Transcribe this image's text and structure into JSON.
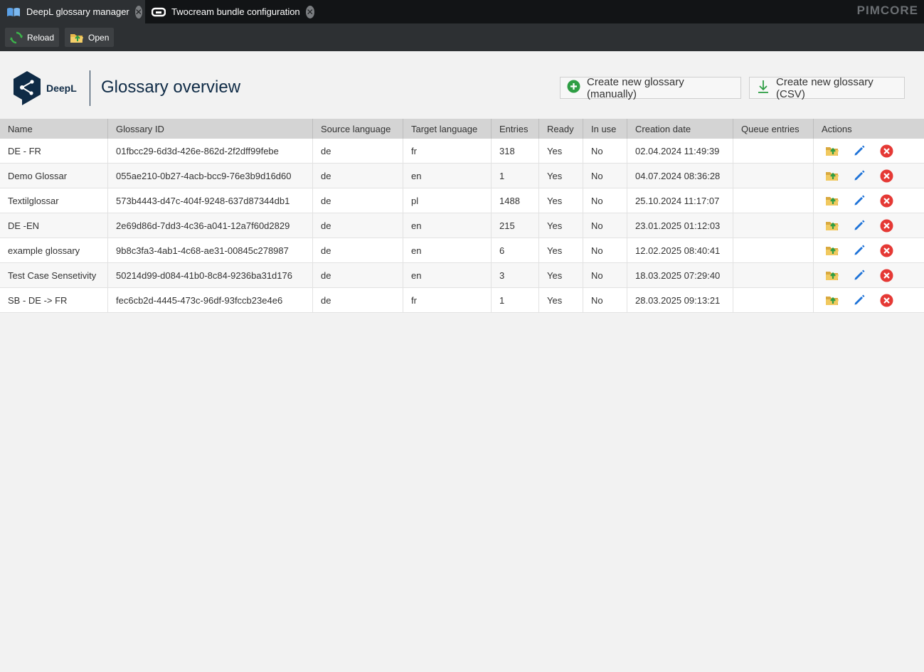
{
  "tabs": [
    {
      "label": "DeepL glossary manager",
      "icon": "book-icon",
      "active": true
    },
    {
      "label": "Twocream bundle configuration",
      "icon": "bundle-icon",
      "active": false
    }
  ],
  "brand": "PIMCORE",
  "toolbar": {
    "reload_label": "Reload",
    "open_label": "Open"
  },
  "header": {
    "logo_text": "DeepL",
    "title": "Glossary overview",
    "create_manual_label": "Create new glossary (manually)",
    "create_csv_label": "Create new glossary (CSV)"
  },
  "grid": {
    "columns": [
      "Name",
      "Glossary ID",
      "Source language",
      "Target language",
      "Entries",
      "Ready",
      "In use",
      "Creation date",
      "Queue entries",
      "Actions"
    ],
    "rows": [
      {
        "name": "DE - FR",
        "id": "01fbcc29-6d3d-426e-862d-2f2dff99febe",
        "source": "de",
        "target": "fr",
        "entries": "318",
        "ready": "Yes",
        "in_use": "No",
        "created": "02.04.2024 11:49:39",
        "queue": ""
      },
      {
        "name": "Demo Glossar",
        "id": "055ae210-0b27-4acb-bcc9-76e3b9d16d60",
        "source": "de",
        "target": "en",
        "entries": "1",
        "ready": "Yes",
        "in_use": "No",
        "created": "04.07.2024 08:36:28",
        "queue": ""
      },
      {
        "name": "Textilglossar",
        "id": "573b4443-d47c-404f-9248-637d87344db1",
        "source": "de",
        "target": "pl",
        "entries": "1488",
        "ready": "Yes",
        "in_use": "No",
        "created": "25.10.2024 11:17:07",
        "queue": ""
      },
      {
        "name": "DE -EN",
        "id": "2e69d86d-7dd3-4c36-a041-12a7f60d2829",
        "source": "de",
        "target": "en",
        "entries": "215",
        "ready": "Yes",
        "in_use": "No",
        "created": "23.01.2025 01:12:03",
        "queue": ""
      },
      {
        "name": "example glossary",
        "id": "9b8c3fa3-4ab1-4c68-ae31-00845c278987",
        "source": "de",
        "target": "en",
        "entries": "6",
        "ready": "Yes",
        "in_use": "No",
        "created": "12.02.2025 08:40:41",
        "queue": ""
      },
      {
        "name": "Test Case Sensetivity",
        "id": "50214d99-d084-41b0-8c84-9236ba31d176",
        "source": "de",
        "target": "en",
        "entries": "3",
        "ready": "Yes",
        "in_use": "No",
        "created": "18.03.2025 07:29:40",
        "queue": ""
      },
      {
        "name": "SB - DE -> FR",
        "id": "fec6cb2d-4445-473c-96df-93fccb23e4e6",
        "source": "de",
        "target": "fr",
        "entries": "1",
        "ready": "Yes",
        "in_use": "No",
        "created": "28.03.2025 09:13:21",
        "queue": ""
      }
    ],
    "action_icons": [
      "folder-upload-icon",
      "pencil-icon",
      "delete-icon"
    ]
  },
  "colors": {
    "accent": "#0f2b46",
    "delete": "#e53935",
    "edit": "#1e73d8",
    "add": "#2e9e44"
  }
}
